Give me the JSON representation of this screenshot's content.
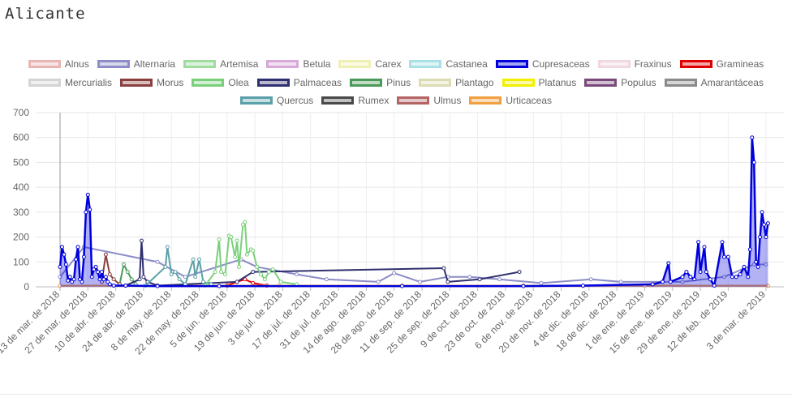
{
  "page": {
    "title": "Alicante"
  },
  "legend": {
    "rows": [
      [
        {
          "name": "Alnus",
          "color": "#e8b4b4"
        },
        {
          "name": "Alternaria",
          "color": "#8c8cc8"
        },
        {
          "name": "Artemisa",
          "color": "#a0dca0"
        },
        {
          "name": "Betula",
          "color": "#d8a8d8"
        },
        {
          "name": "Carex",
          "color": "#f0f0b4"
        },
        {
          "name": "Castanea",
          "color": "#a8e0e8"
        },
        {
          "name": "Cupresaceas",
          "color": "#0000dd"
        },
        {
          "name": "Fraxinus",
          "color": "#f0d8e0"
        },
        {
          "name": "Gramineas",
          "color": "#e00000"
        }
      ],
      [
        {
          "name": "Mercurialis",
          "color": "#d4d4d4"
        },
        {
          "name": "Morus",
          "color": "#8b4040"
        },
        {
          "name": "Olea",
          "color": "#7ad07a"
        },
        {
          "name": "Palmaceas",
          "color": "#303070"
        },
        {
          "name": "Pinus",
          "color": "#4a9a5a"
        },
        {
          "name": "Plantago",
          "color": "#dcdcb4"
        },
        {
          "name": "Platanus",
          "color": "#f0f000"
        },
        {
          "name": "Populus",
          "color": "#7a4a7a"
        },
        {
          "name": "Amarantáceas",
          "color": "#8a8a8a"
        }
      ],
      [
        {
          "name": "Quercus",
          "color": "#5aa0a8"
        },
        {
          "name": "Rumex",
          "color": "#4a4a4a"
        },
        {
          "name": "Ulmus",
          "color": "#b46464"
        },
        {
          "name": "Urticaceas",
          "color": "#f0a040"
        }
      ]
    ]
  },
  "chart_data": {
    "type": "line",
    "ylim": [
      0,
      700
    ],
    "yticks": [
      0,
      100,
      200,
      300,
      400,
      500,
      600,
      700
    ],
    "xlim": [
      "2018-03-13",
      "2019-03-12"
    ],
    "x_tick_labels": [
      {
        "date": "2018-03-13",
        "label": "13 de mar. de 2018"
      },
      {
        "date": "2018-03-27",
        "label": "27 de mar. de 2018"
      },
      {
        "date": "2018-04-10",
        "label": "10 de abr. de 2018"
      },
      {
        "date": "2018-04-24",
        "label": "24 de abr. de 2018"
      },
      {
        "date": "2018-05-08",
        "label": "8 de may. de 2018"
      },
      {
        "date": "2018-05-22",
        "label": "22 de may. de 2018"
      },
      {
        "date": "2018-06-05",
        "label": "5 de jun. de 2018"
      },
      {
        "date": "2018-06-19",
        "label": "19 de jun. de 2018"
      },
      {
        "date": "2018-07-03",
        "label": "3 de jul. de 2018"
      },
      {
        "date": "2018-07-17",
        "label": "17 de jul. de 2018"
      },
      {
        "date": "2018-07-31",
        "label": "31 de jul. de 2018"
      },
      {
        "date": "2018-08-14",
        "label": "14 de ago. de 2018"
      },
      {
        "date": "2018-08-28",
        "label": "28 de ago. de 2018"
      },
      {
        "date": "2018-09-11",
        "label": "11 de sep. de 2018"
      },
      {
        "date": "2018-09-25",
        "label": "25 de sep. de 2018"
      },
      {
        "date": "2018-10-09",
        "label": "9 de oct. de 2018"
      },
      {
        "date": "2018-10-23",
        "label": "23 de oct. de 2018"
      },
      {
        "date": "2018-11-06",
        "label": "6 de nov. de 2018"
      },
      {
        "date": "2018-11-20",
        "label": "20 de nov. de 2018"
      },
      {
        "date": "2018-12-04",
        "label": "4 de dic. de 2018"
      },
      {
        "date": "2018-12-18",
        "label": "18 de dic. de 2018"
      },
      {
        "date": "2019-01-01",
        "label": "1 de ene. de 2019"
      },
      {
        "date": "2019-01-15",
        "label": "15 de ene. de 2019"
      },
      {
        "date": "2019-01-29",
        "label": "29 de ene. de 2019"
      },
      {
        "date": "2019-02-12",
        "label": "12 de feb. de 2019"
      },
      {
        "date": "2019-03-03",
        "label": "3 de mar. de 2019"
      }
    ],
    "grid": true,
    "legend_position": "top",
    "series": [
      {
        "name": "Cupresaceas",
        "color": "#0000dd",
        "fill": true,
        "points": [
          [
            "2018-03-13",
            80
          ],
          [
            "2018-03-14",
            160
          ],
          [
            "2018-03-15",
            130
          ],
          [
            "2018-03-16",
            90
          ],
          [
            "2018-03-17",
            25
          ],
          [
            "2018-03-18",
            40
          ],
          [
            "2018-03-19",
            20
          ],
          [
            "2018-03-20",
            30
          ],
          [
            "2018-03-21",
            110
          ],
          [
            "2018-03-22",
            160
          ],
          [
            "2018-03-23",
            30
          ],
          [
            "2018-03-24",
            20
          ],
          [
            "2018-03-25",
            120
          ],
          [
            "2018-03-26",
            300
          ],
          [
            "2018-03-27",
            370
          ],
          [
            "2018-03-28",
            310
          ],
          [
            "2018-03-29",
            40
          ],
          [
            "2018-03-30",
            70
          ],
          [
            "2018-03-31",
            80
          ],
          [
            "2018-04-01",
            60
          ],
          [
            "2018-04-02",
            30
          ],
          [
            "2018-04-03",
            60
          ],
          [
            "2018-04-04",
            30
          ],
          [
            "2018-04-05",
            40
          ],
          [
            "2018-04-06",
            20
          ],
          [
            "2018-04-07",
            10
          ],
          [
            "2018-04-09",
            5
          ],
          [
            "2018-04-15",
            5
          ],
          [
            "2018-05-01",
            3
          ],
          [
            "2018-06-01",
            3
          ],
          [
            "2018-09-01",
            3
          ],
          [
            "2018-11-01",
            3
          ],
          [
            "2018-12-01",
            5
          ],
          [
            "2019-01-05",
            10
          ],
          [
            "2019-01-10",
            20
          ],
          [
            "2019-01-13",
            95
          ],
          [
            "2019-01-14",
            20
          ],
          [
            "2019-01-20",
            40
          ],
          [
            "2019-01-22",
            60
          ],
          [
            "2019-01-24",
            40
          ],
          [
            "2019-01-26",
            30
          ],
          [
            "2019-01-28",
            180
          ],
          [
            "2019-01-29",
            60
          ],
          [
            "2019-01-31",
            160
          ],
          [
            "2019-02-01",
            60
          ],
          [
            "2019-02-03",
            30
          ],
          [
            "2019-02-05",
            5
          ],
          [
            "2019-02-09",
            180
          ],
          [
            "2019-02-10",
            120
          ],
          [
            "2019-02-12",
            120
          ],
          [
            "2019-02-14",
            40
          ],
          [
            "2019-02-16",
            40
          ],
          [
            "2019-02-18",
            50
          ],
          [
            "2019-02-20",
            80
          ],
          [
            "2019-02-22",
            40
          ],
          [
            "2019-02-23",
            150
          ],
          [
            "2019-02-24",
            600
          ],
          [
            "2019-02-25",
            500
          ],
          [
            "2019-02-26",
            100
          ],
          [
            "2019-02-27",
            80
          ],
          [
            "2019-02-28",
            200
          ],
          [
            "2019-03-01",
            300
          ],
          [
            "2019-03-02",
            250
          ],
          [
            "2019-03-03",
            200
          ],
          [
            "2019-03-04",
            255
          ]
        ]
      },
      {
        "name": "Olea",
        "color": "#7ad07a",
        "fill": false,
        "points": [
          [
            "2018-05-25",
            5
          ],
          [
            "2018-05-30",
            60
          ],
          [
            "2018-06-01",
            190
          ],
          [
            "2018-06-02",
            60
          ],
          [
            "2018-06-04",
            50
          ],
          [
            "2018-06-06",
            205
          ],
          [
            "2018-06-07",
            200
          ],
          [
            "2018-06-09",
            120
          ],
          [
            "2018-06-10",
            185
          ],
          [
            "2018-06-11",
            80
          ],
          [
            "2018-06-13",
            250
          ],
          [
            "2018-06-14",
            260
          ],
          [
            "2018-06-15",
            130
          ],
          [
            "2018-06-17",
            150
          ],
          [
            "2018-06-18",
            145
          ],
          [
            "2018-06-20",
            80
          ],
          [
            "2018-06-22",
            50
          ],
          [
            "2018-06-24",
            30
          ],
          [
            "2018-06-26",
            60
          ],
          [
            "2018-06-28",
            70
          ],
          [
            "2018-07-02",
            20
          ],
          [
            "2018-07-10",
            10
          ]
        ]
      },
      {
        "name": "Quercus",
        "color": "#5aa0a8",
        "fill": false,
        "points": [
          [
            "2018-04-25",
            5
          ],
          [
            "2018-05-05",
            80
          ],
          [
            "2018-05-06",
            160
          ],
          [
            "2018-05-08",
            50
          ],
          [
            "2018-05-10",
            60
          ],
          [
            "2018-05-12",
            30
          ],
          [
            "2018-05-15",
            10
          ],
          [
            "2018-05-19",
            110
          ],
          [
            "2018-05-20",
            40
          ],
          [
            "2018-05-22",
            110
          ],
          [
            "2018-05-24",
            20
          ],
          [
            "2018-05-28",
            10
          ]
        ]
      },
      {
        "name": "Palmaceas",
        "color": "#303070",
        "fill": false,
        "points": [
          [
            "2018-04-15",
            5
          ],
          [
            "2018-04-22",
            30
          ],
          [
            "2018-04-23",
            185
          ],
          [
            "2018-04-24",
            40
          ],
          [
            "2018-04-26",
            20
          ],
          [
            "2018-05-01",
            5
          ],
          [
            "2018-06-10",
            20
          ],
          [
            "2018-06-18",
            60
          ],
          [
            "2018-09-22",
            75
          ],
          [
            "2018-09-24",
            20
          ],
          [
            "2018-10-10",
            30
          ],
          [
            "2018-10-30",
            60
          ]
        ]
      },
      {
        "name": "Morus",
        "color": "#8b4040",
        "fill": false,
        "points": [
          [
            "2018-04-03",
            20
          ],
          [
            "2018-04-05",
            130
          ],
          [
            "2018-04-07",
            50
          ],
          [
            "2018-04-09",
            30
          ],
          [
            "2018-04-12",
            10
          ]
        ]
      },
      {
        "name": "Pinus",
        "color": "#4a9a5a",
        "fill": false,
        "points": [
          [
            "2018-04-12",
            10
          ],
          [
            "2018-04-14",
            90
          ],
          [
            "2018-04-16",
            60
          ],
          [
            "2018-04-18",
            30
          ],
          [
            "2018-04-20",
            10
          ]
        ]
      },
      {
        "name": "Alternaria",
        "color": "#8c8cc8",
        "fill": false,
        "points": [
          [
            "2018-03-13",
            40
          ],
          [
            "2018-03-25",
            160
          ],
          [
            "2018-05-01",
            100
          ],
          [
            "2018-05-15",
            40
          ],
          [
            "2018-06-12",
            110
          ],
          [
            "2018-06-20",
            80
          ],
          [
            "2018-07-10",
            50
          ],
          [
            "2018-07-25",
            30
          ],
          [
            "2018-08-20",
            20
          ],
          [
            "2018-08-28",
            55
          ],
          [
            "2018-09-10",
            20
          ],
          [
            "2018-09-24",
            40
          ],
          [
            "2018-10-05",
            40
          ],
          [
            "2018-10-20",
            30
          ],
          [
            "2018-11-10",
            15
          ],
          [
            "2018-12-05",
            30
          ],
          [
            "2018-12-20",
            20
          ],
          [
            "2019-01-20",
            20
          ],
          [
            "2019-02-10",
            40
          ],
          [
            "2019-02-25",
            90
          ],
          [
            "2019-03-03",
            90
          ]
        ]
      },
      {
        "name": "Urticaceas",
        "color": "#f0a040",
        "fill": false,
        "points": [
          [
            "2018-03-13",
            5
          ],
          [
            "2018-05-01",
            5
          ],
          [
            "2018-07-01",
            5
          ],
          [
            "2018-09-01",
            5
          ],
          [
            "2018-11-01",
            5
          ],
          [
            "2019-01-01",
            5
          ],
          [
            "2019-03-04",
            5
          ]
        ]
      },
      {
        "name": "Alnus",
        "color": "#e8b4b4",
        "fill": false,
        "points": [
          [
            "2018-03-13",
            3
          ],
          [
            "2018-06-01",
            3
          ],
          [
            "2018-09-01",
            3
          ],
          [
            "2018-12-01",
            3
          ],
          [
            "2019-03-04",
            3
          ]
        ]
      },
      {
        "name": "Gramineas",
        "color": "#e00000",
        "fill": false,
        "points": [
          [
            "2018-06-05",
            5
          ],
          [
            "2018-06-10",
            20
          ],
          [
            "2018-06-14",
            30
          ],
          [
            "2018-06-18",
            15
          ],
          [
            "2018-06-25",
            5
          ]
        ]
      }
    ]
  }
}
